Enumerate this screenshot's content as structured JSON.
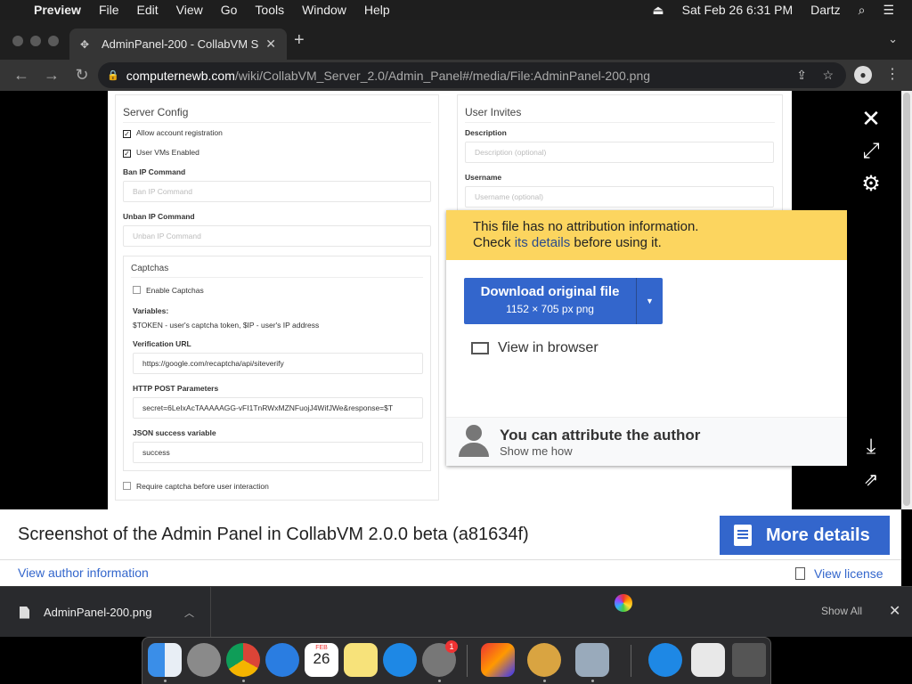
{
  "menubar": {
    "app": "Preview",
    "items": [
      "File",
      "Edit",
      "View",
      "Go",
      "Tools",
      "Window",
      "Help"
    ],
    "datetime": "Sat Feb 26  6:31 PM",
    "user": "Dartz"
  },
  "browser": {
    "tab_title": "AdminPanel-200 - CollabVM S",
    "url_host": "computernewb.com",
    "url_path": "/wiki/CollabVM_Server_2.0/Admin_Panel#/media/File:AdminPanel-200.png"
  },
  "shot": {
    "server_config": {
      "title": "Server Config",
      "allow_registration": "Allow account registration",
      "user_vms": "User VMs Enabled",
      "ban_label": "Ban IP Command",
      "ban_placeholder": "Ban IP Command",
      "unban_label": "Unban IP Command",
      "unban_placeholder": "Unban IP Command",
      "captchas": {
        "title": "Captchas",
        "enable": "Enable Captchas",
        "variables_label": "Variables:",
        "variables_text": "$TOKEN - user's captcha token, $IP - user's IP address",
        "verif_label": "Verification URL",
        "verif_value": "https://google.com/recaptcha/api/siteverify",
        "post_label": "HTTP POST Parameters",
        "post_value": "secret=6LeIxAcTAAAAAGG-vFI1TnRWxMZNFuojJ4WifJWe&response=$T",
        "json_label": "JSON success variable",
        "json_value": "success"
      },
      "require_captcha": "Require captcha before user interaction"
    },
    "user_invites": {
      "title": "User Invites",
      "desc_label": "Description",
      "desc_placeholder": "Description (optional)",
      "user_label": "Username",
      "user_placeholder": "Username (optional)"
    }
  },
  "popup": {
    "warn_line1": "This file has no attribution information.",
    "warn_line2_pre": "Check ",
    "warn_link": "its details",
    "warn_line2_post": " before using it.",
    "download_label": "Download original file",
    "download_sub": "1152 × 705 px png",
    "view_browser": "View in browser",
    "attr_title": "You can attribute the author",
    "attr_sub": "Show me how"
  },
  "caption": {
    "description": "Screenshot of the Admin Panel in CollabVM 2.0.0 beta (a81634f)",
    "more_details": "More details",
    "author_link": "View author information",
    "license_link": "View license"
  },
  "downloads": {
    "filename": "AdminPanel-200.png",
    "show_all": "Show All"
  },
  "dock": {
    "calendar_month": "FEB",
    "calendar_day": "26",
    "settings_badge": "1"
  }
}
